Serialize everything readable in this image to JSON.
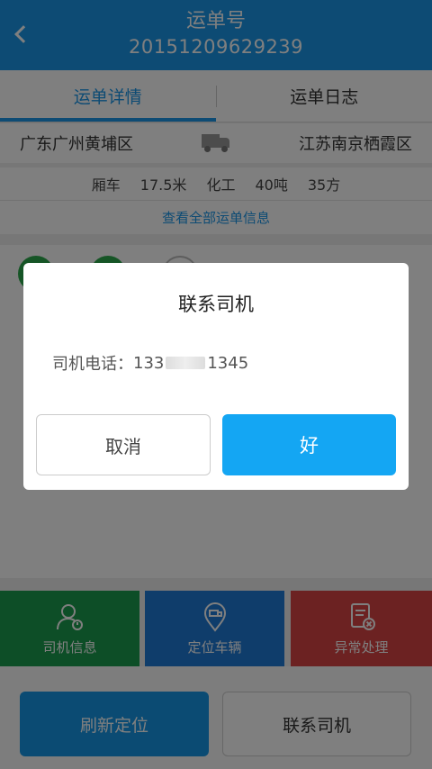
{
  "header": {
    "title": "运单号",
    "order_no": "20151209629239"
  },
  "tabs": [
    {
      "label": "运单详情"
    },
    {
      "label": "运单日志"
    }
  ],
  "route": {
    "from": "广东广州黄埔区",
    "to": "江苏南京栖霞区",
    "icon": "truck-icon"
  },
  "specs": [
    "厢车",
    "17.5米",
    "化工",
    "40吨",
    "35方"
  ],
  "view_all": "查看全部运单信息",
  "actions": [
    {
      "label": "司机信息",
      "icon": "driver-info-icon",
      "color": "#1a9d4e"
    },
    {
      "label": "定位车辆",
      "icon": "locate-vehicle-icon",
      "color": "#1f7bd6"
    },
    {
      "label": "异常处理",
      "icon": "exception-icon",
      "color": "#d84545"
    }
  ],
  "bottom": {
    "refresh_label": "刷新定位",
    "contact_label": "联系司机"
  },
  "dialog": {
    "title": "联系司机",
    "phone_label": "司机电话：",
    "phone_prefix": "133",
    "phone_suffix": "1345",
    "cancel_label": "取消",
    "ok_label": "好"
  },
  "colors": {
    "primary": "#1b96e8",
    "ok_button": "#14a6f3"
  }
}
